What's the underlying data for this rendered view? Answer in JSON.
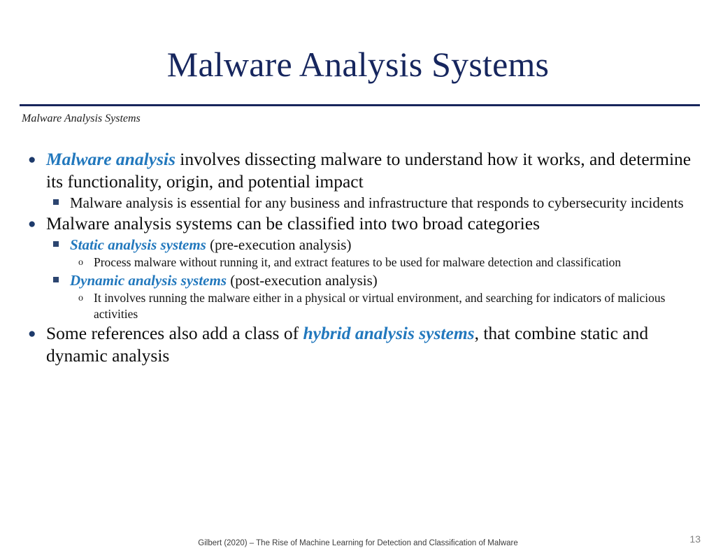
{
  "slide": {
    "title": "Malware Analysis Systems",
    "sub_header": "Malware Analysis Systems",
    "page_number": "13",
    "footer": "Gilbert (2020) – The Rise of Machine Learning for Detection and Classification of Malware",
    "colors": {
      "title": "#16265e",
      "rule": "#17255c",
      "accent": "#2278bd",
      "body_text": "#0d0d0d",
      "bullet_level1": "#1d3a6b",
      "bullet_level2": "#2c4570",
      "footer_text": "#3d3d3d",
      "page_number": "#808080"
    },
    "bullets": {
      "level1_glyph": "●",
      "level2_glyph": "■",
      "level3_glyph": "o"
    }
  },
  "content": {
    "b1": {
      "accent": "Malware analysis",
      "rest": " involves dissecting malware to understand how it works, and determine its functionality, origin, and potential impact"
    },
    "b1_sub1": "Malware analysis is essential for any business and infrastructure that responds to cybersecurity incidents",
    "b2": "Malware analysis systems can be classified into two broad categories",
    "b2_sub1": {
      "accent": "Static analysis systems",
      "rest": " (pre-execution analysis)"
    },
    "b2_sub1_sub1": "Process malware without running it, and extract features to be used for malware detection and classification",
    "b2_sub2": {
      "accent": "Dynamic analysis systems",
      "rest": " (post-execution analysis)"
    },
    "b2_sub2_sub1": "It involves running the malware either in a physical or virtual environment, and searching for indicators of malicious activities",
    "b3": {
      "pre": "Some references also add a class of ",
      "accent": "hybrid analysis systems",
      "post": ", that combine static and dynamic analysis"
    }
  }
}
